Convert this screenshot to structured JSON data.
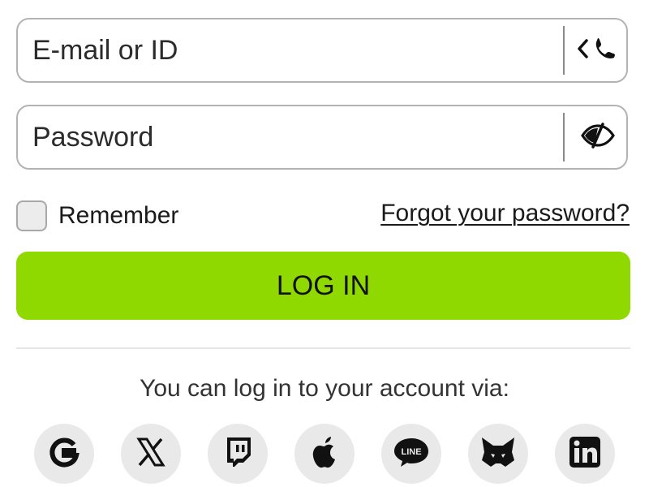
{
  "theme": {
    "accent": "#8fd900",
    "border": "#b3b3b3",
    "text": "#1a1a1a",
    "social_bg": "#e9e9e9"
  },
  "login_form": {
    "email": {
      "placeholder": "E-mail or ID",
      "value": "",
      "trailing_icon": "phone-switch-icon"
    },
    "password": {
      "placeholder": "Password",
      "value": "",
      "trailing_icon": "eye-off-icon"
    },
    "remember_label": "Remember",
    "remember_checked": false,
    "forgot_link": "Forgot your password?",
    "submit_label": "LOG IN"
  },
  "social_login": {
    "prompt": "You can log in to your account via:",
    "providers": [
      {
        "name": "google",
        "icon": "google-icon"
      },
      {
        "name": "x",
        "icon": "x-icon"
      },
      {
        "name": "twitch",
        "icon": "twitch-icon"
      },
      {
        "name": "apple",
        "icon": "apple-icon"
      },
      {
        "name": "line",
        "icon": "line-icon",
        "icon_text": "LINE"
      },
      {
        "name": "metamask",
        "icon": "metamask-icon"
      },
      {
        "name": "linkedin",
        "icon": "linkedin-icon",
        "icon_text": "in"
      }
    ]
  }
}
